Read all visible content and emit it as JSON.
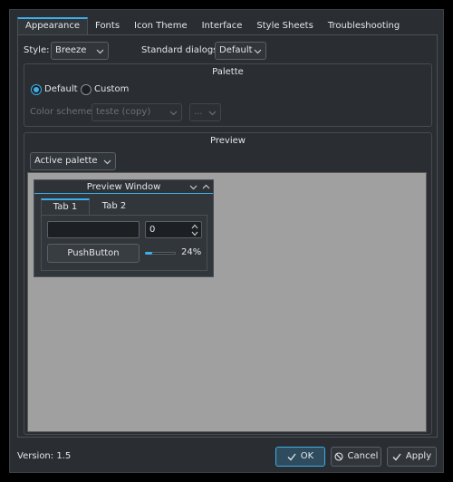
{
  "tabs": [
    {
      "label": "Appearance",
      "active": true
    },
    {
      "label": "Fonts"
    },
    {
      "label": "Icon Theme"
    },
    {
      "label": "Interface"
    },
    {
      "label": "Style Sheets"
    },
    {
      "label": "Troubleshooting"
    }
  ],
  "style_row": {
    "style_label": "Style:",
    "style_value": "Breeze",
    "dialogs_label": "Standard dialogs:",
    "dialogs_value": "Default"
  },
  "palette": {
    "title": "Palette",
    "default_label": "Default",
    "custom_label": "Custom",
    "selected": "Default",
    "scheme_label": "Color scheme:",
    "scheme_value": "teste (copy)",
    "scheme_menu": "..."
  },
  "preview": {
    "title": "Preview",
    "palette_select": "Active palette",
    "window_title": "Preview Window",
    "tab1": "Tab 1",
    "tab2": "Tab 2",
    "spin_value": "0",
    "push_button": "PushButton",
    "progress_label": "24%",
    "slider_fraction": 0.24
  },
  "footer": {
    "version": "Version: 1.5",
    "ok": "OK",
    "cancel": "Cancel",
    "apply": "Apply"
  },
  "colors": {
    "accent": "#3daee9",
    "window_bg": "#2a2e32",
    "canvas_bg": "#a0a0a0"
  }
}
